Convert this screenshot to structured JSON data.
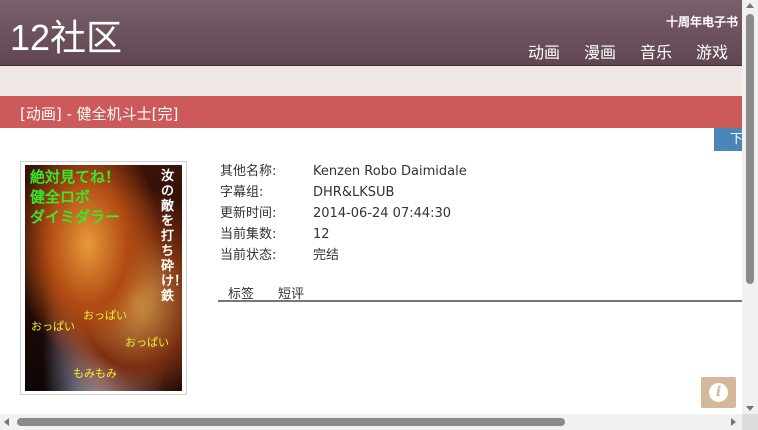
{
  "header": {
    "logo": "12社区",
    "anniversary_link": "十周年电子书",
    "nav": [
      "动画",
      "漫画",
      "音乐",
      "游戏"
    ]
  },
  "title_bar": "[动画] - 健全机斗士[完]",
  "download_button": "下",
  "cover": {
    "text_green": [
      "絶対見てね！",
      "健全ロボ",
      "ダイミダラー"
    ],
    "text_white_vertical": "汝の敵を打ち砕け！鉄",
    "text_yellow": [
      "おっぱい",
      "おっぱい",
      "おっぱい",
      "もみもみ"
    ]
  },
  "info": {
    "fields": [
      {
        "label": "其他名称:",
        "value": "Kenzen Robo Daimidale"
      },
      {
        "label": "字幕组:",
        "value": "DHR&LKSUB"
      },
      {
        "label": "更新时间:",
        "value": "2014-06-24 07:44:30"
      },
      {
        "label": "当前集数:",
        "value": "12"
      },
      {
        "label": "当前状态:",
        "value": "完结"
      }
    ]
  },
  "tabs": [
    "标签",
    "短评"
  ],
  "info_button_icon": "info-icon",
  "colors": {
    "header_bg": "#6b5260",
    "title_bar_bg": "#cd5a5a",
    "download_bg": "#4a86b8",
    "info_btn_bg": "#d4b89a"
  }
}
